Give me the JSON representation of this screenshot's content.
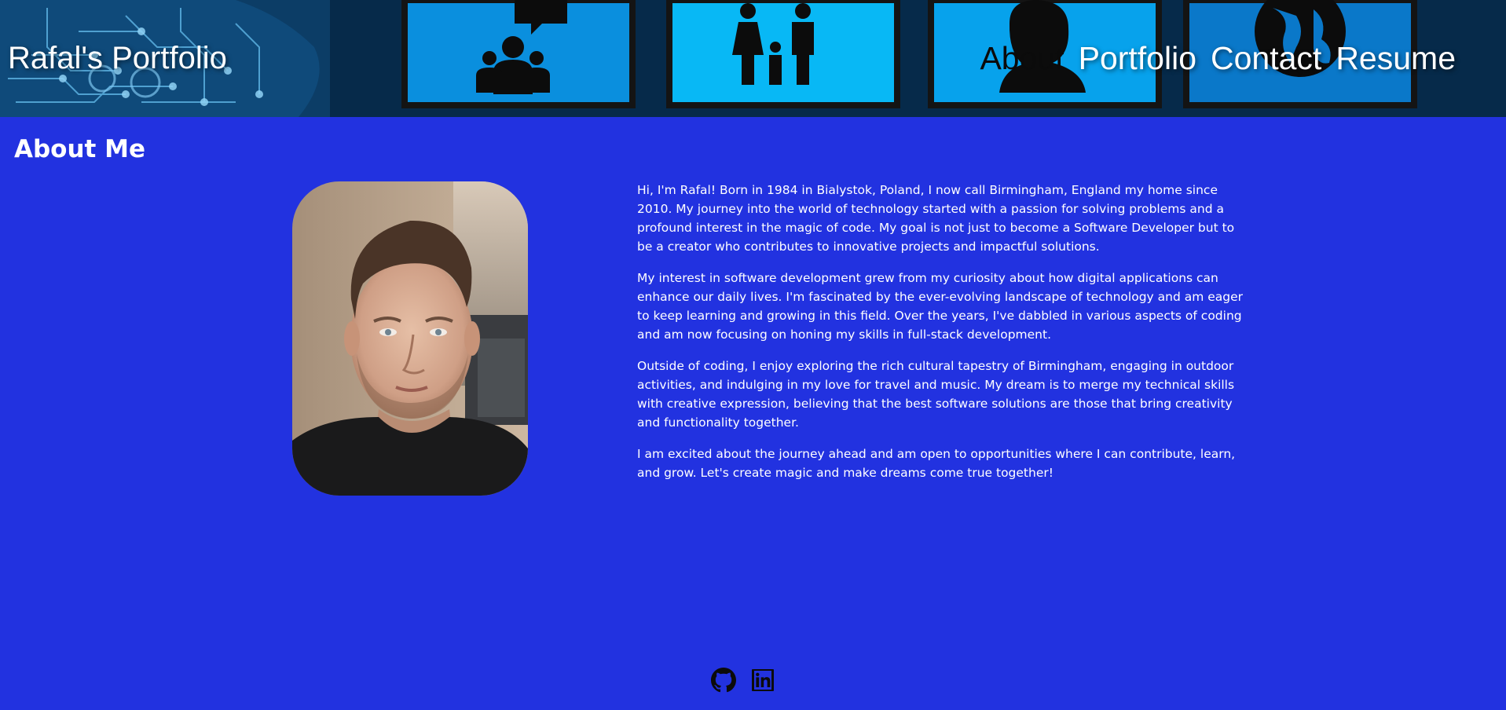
{
  "header": {
    "site_title": "Rafal's Portfolio",
    "nav": [
      {
        "label": "About",
        "active": true
      },
      {
        "label": "Portfolio",
        "active": false
      },
      {
        "label": "Contact",
        "active": false
      },
      {
        "label": "Resume",
        "active": false
      }
    ],
    "banner_icons": [
      "people-group-icon",
      "family-icon",
      "person-icon",
      "globe-icon",
      "circuit-board-icon"
    ]
  },
  "about": {
    "heading": "About Me",
    "portrait": "profile-photo",
    "paragraphs": [
      "Hi, I'm Rafal! Born in 1984 in Bialystok, Poland, I now call Birmingham, England my home since 2010. My journey into the world of technology started with a passion for solving problems and a profound interest in the magic of code. My goal is not just to become a Software Developer but to be a creator who contributes to innovative projects and impactful solutions.",
      "My interest in software development grew from my curiosity about how digital applications can enhance our daily lives. I'm fascinated by the ever-evolving landscape of technology and am eager to keep learning and growing in this field. Over the years, I've dabbled in various aspects of coding and am now focusing on honing my skills in full-stack development.",
      "Outside of coding, I enjoy exploring the rich cultural tapestry of Birmingham, engaging in outdoor activities, and indulging in my love for travel and music. My dream is to merge my technical skills with creative expression, believing that the best software solutions are those that bring creativity and functionality together.",
      "I am excited about the journey ahead and am open to opportunities where I can contribute, learn, and grow. Let's create magic and make dreams come true together!"
    ]
  },
  "footer": {
    "links": [
      {
        "icon": "github-icon"
      },
      {
        "icon": "linkedin-icon"
      }
    ]
  },
  "colors": {
    "background": "#2232e0",
    "text": "#ffffff",
    "active_nav": "#0b0b0b"
  }
}
